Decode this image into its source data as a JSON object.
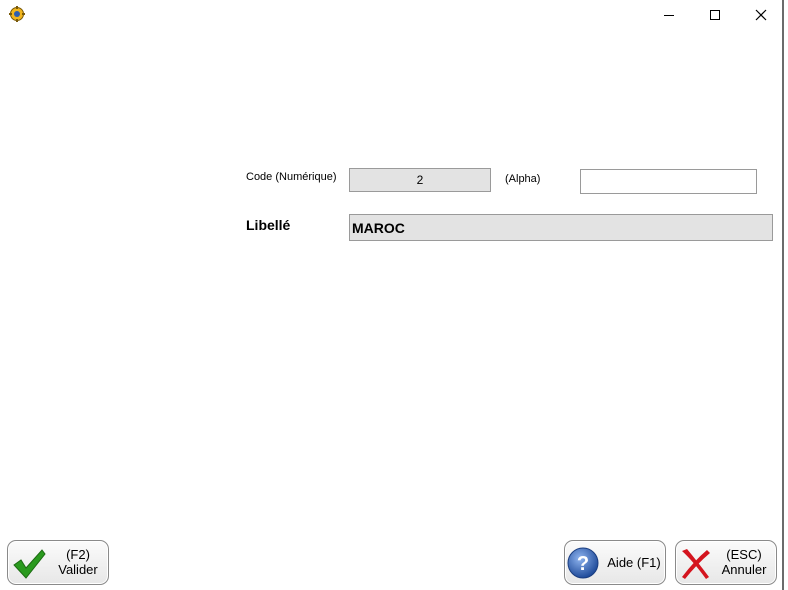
{
  "window": {
    "minimize_glyph": "—",
    "maximize_glyph": "☐",
    "close_glyph": "✕"
  },
  "form": {
    "code_label": "Code (Numérique)",
    "code_value": "2",
    "alpha_label": "(Alpha)",
    "alpha_value": "",
    "libelle_label": "Libellé",
    "libelle_value": "MAROC"
  },
  "buttons": {
    "valider": {
      "key": "(F2)",
      "label": "Valider"
    },
    "aide": {
      "label": "Aide (F1)"
    },
    "annuler": {
      "key": "(ESC)",
      "label": "Annuler"
    }
  },
  "colors": {
    "valider_check": "#2a9a1e",
    "aide_circle": "#2f5fb0",
    "annuler_x": "#d4141e"
  },
  "icons": [
    "app-gear-icon",
    "minimize-icon",
    "maximize-icon",
    "close-icon",
    "checkmark-icon",
    "help-question-icon",
    "cancel-x-icon"
  ]
}
